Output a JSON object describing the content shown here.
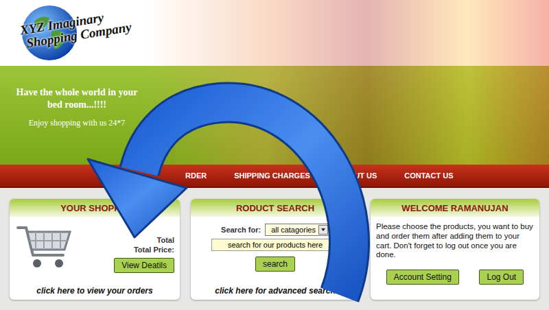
{
  "logo": {
    "line1": "XYZ Imaginary",
    "line2": "Shopping Company"
  },
  "banner": {
    "headline": "Have the whole world in your bed room...!!!!",
    "subline": "Enjoy shopping with us 24*7"
  },
  "nav": [
    {
      "label": "RDER"
    },
    {
      "label": "SHIPPING CHARGES"
    },
    {
      "label": "ABOUT US"
    },
    {
      "label": "CONTACT US"
    }
  ],
  "cart": {
    "title": "YOUR SHOPPIN",
    "lines": [
      "Total",
      "Total Price:"
    ],
    "button": "View Deatils",
    "link": "click here to view your orders"
  },
  "search": {
    "title": "RODUCT SEARCH",
    "label": "Search for:",
    "category": "all catagories",
    "value": "search for our products here",
    "button": "search",
    "link": "click here for advanced search"
  },
  "welcome": {
    "title": "WELCOME RAMANUJAN",
    "message": "Please choose the products, you want to buy and order them after adding them to your cart. Don't forget to log out once you are done.",
    "buttons": [
      "Account Setting",
      "Log Out"
    ]
  }
}
